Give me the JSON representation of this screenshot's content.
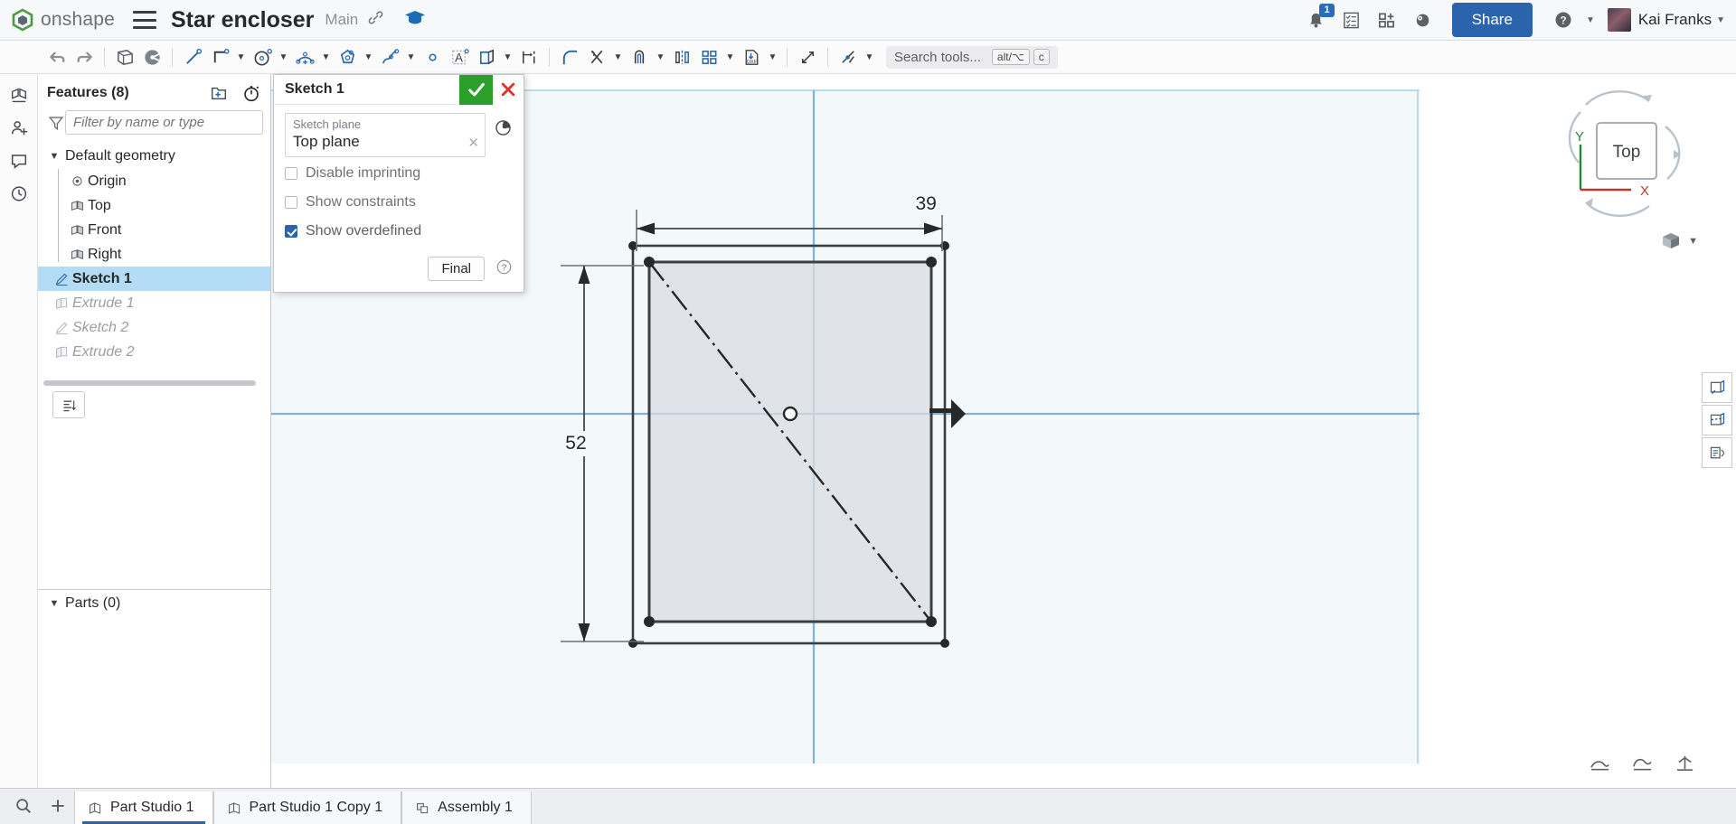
{
  "header": {
    "brand": "onshape",
    "logo_icon": "onshape-logo-icon",
    "menu_icon": "hamburger-menu-icon",
    "document_title": "Star encloser",
    "branch": "Main",
    "link_icon": "link-icon",
    "learning_icon": "graduation-cap-icon",
    "notifications_icon": "bell-icon",
    "notifications_count": "1",
    "tasks_icon": "checklist-icon",
    "apps_icon": "app-grid-plus-icon",
    "analytics_icon": "brain-gear-icon",
    "share_label": "Share",
    "help_icon": "help-circle-icon",
    "user_name": "Kai Franks",
    "avatar_icon": "user-avatar",
    "accent_color": "#2a64ad"
  },
  "toolbar": {
    "items": [
      {
        "name": "undo-icon",
        "label": "Undo"
      },
      {
        "name": "redo-icon",
        "label": "Redo"
      },
      {
        "name": "sketch-icon",
        "label": "Sketch"
      },
      {
        "name": "plane-icon",
        "label": "Plane"
      },
      {
        "name": "line-icon",
        "label": "Line"
      },
      {
        "name": "rectangle-icon",
        "label": "Corner rectangle"
      },
      {
        "name": "circle-icon",
        "label": "Circle"
      },
      {
        "name": "arc-icon",
        "label": "Arc"
      },
      {
        "name": "polygon-icon",
        "label": "Polygon"
      },
      {
        "name": "spline-icon",
        "label": "Spline"
      },
      {
        "name": "point-icon",
        "label": "Point"
      },
      {
        "name": "text-icon",
        "label": "Text"
      },
      {
        "name": "use-project-icon",
        "label": "Use (project/convert)"
      },
      {
        "name": "dimension-icon",
        "label": "Dimension"
      },
      {
        "name": "fillet-icon",
        "label": "Sketch fillet"
      },
      {
        "name": "trim-icon",
        "label": "Trim"
      },
      {
        "name": "offset-icon",
        "label": "Offset"
      },
      {
        "name": "mirror-icon",
        "label": "Mirror"
      },
      {
        "name": "pattern-icon",
        "label": "Linear pattern"
      },
      {
        "name": "dxf-export-icon",
        "label": "Export DXF"
      },
      {
        "name": "measure-icon",
        "label": "Measure"
      },
      {
        "name": "constraint-icon",
        "label": "Constraints"
      }
    ],
    "search_placeholder": "Search tools...",
    "shortcut_alt": "alt/⌥",
    "shortcut_key": "c",
    "search_icon": "search-icon"
  },
  "sidebar": {
    "features_title": "Features (8)",
    "new_folder_icon": "new-folder-icon",
    "rollback_icon": "stopwatch-icon",
    "filter_icon": "filter-funnel-icon",
    "filter_placeholder": "Filter by name or type",
    "list_view_icon": "list-view-icon",
    "default_geometry": {
      "label": "Default geometry",
      "expand_icon": "chevron-down-icon",
      "items": [
        {
          "label": "Origin",
          "icon": "origin-icon"
        },
        {
          "label": "Top",
          "icon": "plane-icon"
        },
        {
          "label": "Front",
          "icon": "plane-icon"
        },
        {
          "label": "Right",
          "icon": "plane-icon"
        }
      ]
    },
    "features": [
      {
        "label": "Sketch 1",
        "icon": "sketch-icon",
        "state": "selected"
      },
      {
        "label": "Extrude 1",
        "icon": "extrude-icon",
        "state": "suppressed"
      },
      {
        "label": "Sketch 2",
        "icon": "sketch-icon",
        "state": "suppressed"
      },
      {
        "label": "Extrude 2",
        "icon": "extrude-icon",
        "state": "suppressed"
      }
    ],
    "parts_title": "Parts (0)",
    "parts_expand_icon": "chevron-down-icon"
  },
  "sketch_dialog": {
    "title": "Sketch 1",
    "accept_icon": "checkmark-icon",
    "cancel_icon": "x-mark-icon",
    "accept_color": "#2aa02a",
    "cancel_color": "#e03131",
    "plane_field_label": "Sketch plane",
    "plane_field_value": "Top plane",
    "plane_clear_icon": "clear-x-icon",
    "history_icon": "clock-history-icon",
    "checkboxes": [
      {
        "label": "Disable imprinting",
        "checked": false
      },
      {
        "label": "Show constraints",
        "checked": false
      },
      {
        "label": "Show overdefined",
        "checked": true
      }
    ],
    "final_label": "Final",
    "help_icon": "help-circle-icon"
  },
  "left_rail": {
    "items": [
      {
        "name": "display-states-icon",
        "label": "Display states"
      },
      {
        "name": "add-person-icon",
        "label": "Collaborators"
      },
      {
        "name": "comment-icon",
        "label": "Comments"
      },
      {
        "name": "history-icon",
        "label": "Version history"
      }
    ]
  },
  "canvas": {
    "dimensions": {
      "width": "39",
      "height": "52"
    },
    "view_cube_label": "Top",
    "axis_x_label": "X",
    "axis_y_label": "Y",
    "view_cube_icon": "view-cube-icon",
    "display_mode_icon": "shaded-view-icon",
    "right_tools": [
      {
        "name": "sketch-view-icon",
        "label": "Sketch view"
      },
      {
        "name": "section-view-icon",
        "label": "Section view"
      },
      {
        "name": "constraint-list-icon",
        "label": "Constraint list"
      }
    ],
    "corner_tools": [
      {
        "name": "measure-tool-icon",
        "label": "Measure"
      },
      {
        "name": "mass-properties-icon",
        "label": "Mass properties"
      },
      {
        "name": "sketch-status-icon",
        "label": "Sketch status"
      }
    ]
  },
  "tabs": {
    "search_icon": "tab-search-icon",
    "add_icon": "add-tab-icon",
    "items": [
      {
        "label": "Part Studio 1",
        "icon": "part-studio-icon",
        "active": true
      },
      {
        "label": "Part Studio 1 Copy 1",
        "icon": "part-studio-icon",
        "active": false
      },
      {
        "label": "Assembly 1",
        "icon": "assembly-icon",
        "active": false
      }
    ]
  }
}
